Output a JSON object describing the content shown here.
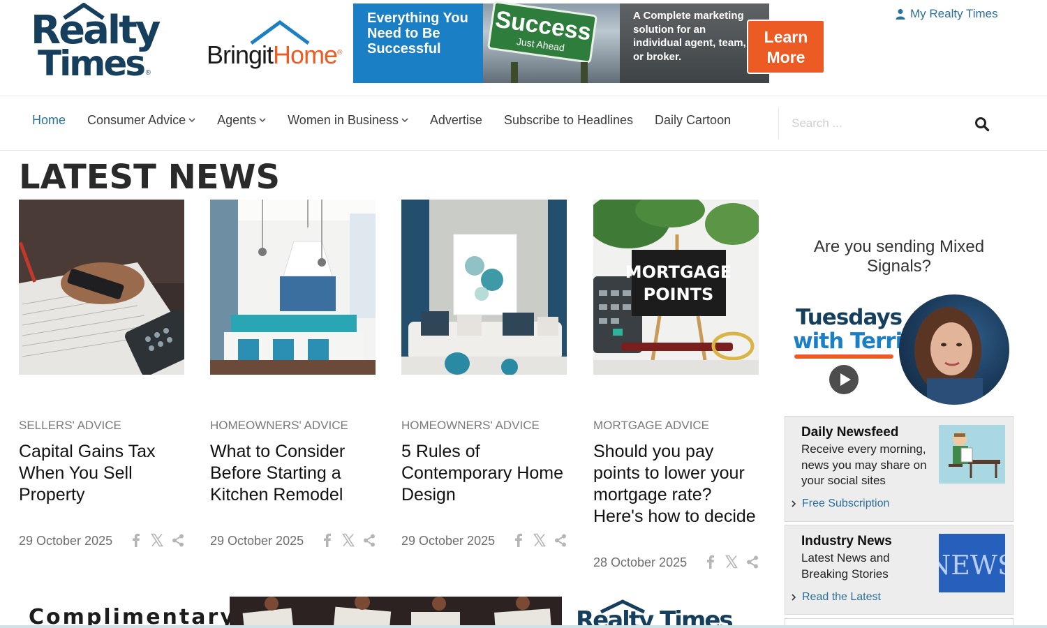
{
  "header": {
    "logo_line1": "Realty",
    "logo_line2": "Times",
    "logo_reg": "®",
    "partner_logo_part1": "Bringit",
    "partner_logo_part2": "Home",
    "partner_logo_reg": "®",
    "ad": {
      "panel1_text": "Everything You Need to Be Successful",
      "sign_big": "Success",
      "sign_small": "Just Ahead",
      "panel3_text": "A Complete marketing solution for an individual agent, team, or broker.",
      "cta": "Learn More"
    },
    "account_link": "My Realty Times"
  },
  "nav": {
    "items": [
      {
        "label": "Home",
        "active": true,
        "has_dropdown": false
      },
      {
        "label": "Consumer Advice",
        "active": false,
        "has_dropdown": true
      },
      {
        "label": "Agents",
        "active": false,
        "has_dropdown": true
      },
      {
        "label": "Women in Business",
        "active": false,
        "has_dropdown": true
      },
      {
        "label": "Advertise",
        "active": false,
        "has_dropdown": false
      },
      {
        "label": "Subscribe to Headlines",
        "active": false,
        "has_dropdown": false
      },
      {
        "label": "Daily Cartoon",
        "active": false,
        "has_dropdown": false
      }
    ],
    "search": {
      "placeholder": "Search ...",
      "value": "",
      "icon": "search-icon"
    }
  },
  "main": {
    "heading": "LATEST NEWS",
    "articles": [
      {
        "category": "SELLERS' ADVICE",
        "title": "Capital Gains Tax When You Sell Property",
        "date": "29 October 2025"
      },
      {
        "category": "HOMEOWNERS' ADVICE",
        "title": "What to Consider Before Starting a Kitchen Remodel",
        "date": "29 October 2025"
      },
      {
        "category": "HOMEOWNERS' ADVICE",
        "title": "5 Rules of Contemporary Home Design",
        "date": "29 October 2025"
      },
      {
        "category": "MORTGAGE ADVICE",
        "title": "Should you pay points to lower your mortgage rate? Here's how to decide",
        "date": "28 October 2025",
        "image_text_1": "MORTGAGE",
        "image_text_2": "POINTS"
      }
    ],
    "bottom_banner": {
      "left_text": "Complimentary",
      "right_text": "Realty Times"
    }
  },
  "sidebar": {
    "promo_question": "Are you sending Mixed Signals?",
    "show_line1": "Tuesdays",
    "show_line2": "with Terri",
    "widgets": [
      {
        "title": "Daily Newsfeed",
        "description": "Receive every morning, news you may share on your social sites",
        "link": "Free Subscription"
      },
      {
        "title": "Industry News",
        "description": "Latest News and Breaking Stories",
        "link": "Read the Latest",
        "image_text": "NEWS"
      }
    ]
  },
  "colors": {
    "brand_navy": "#153f5c",
    "brand_blue": "#2b6f9a",
    "accent_orange": "#ec5b24"
  }
}
